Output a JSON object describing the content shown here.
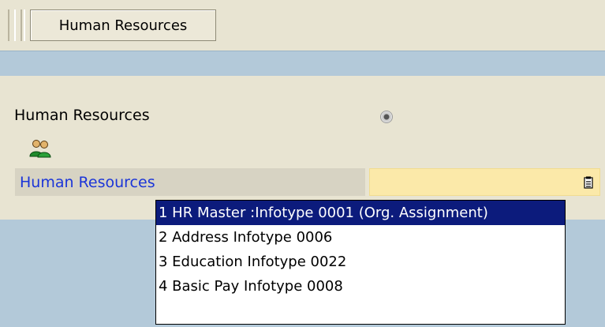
{
  "toolbar": {
    "button_label": "Human Resources"
  },
  "form": {
    "radio_label": "Human Resources",
    "field_label": "Human Resources",
    "field_value": "",
    "icons": {
      "people": "people-icon",
      "radio": "radio-button",
      "value_help": "value-help-icon"
    }
  },
  "dropdown": {
    "items": [
      {
        "label": "1 HR Master :Infotype 0001 (Org. Assignment)",
        "selected": true
      },
      {
        "label": "2 Address Infotype 0006",
        "selected": false
      },
      {
        "label": "3 Education Infotype 0022",
        "selected": false
      },
      {
        "label": "4 Basic Pay Infotype 0008",
        "selected": false
      }
    ]
  },
  "colors": {
    "background": "#e8e4d2",
    "band": "#b3c9d9",
    "label_blue": "#1b35d8",
    "input_yellow": "#fbe9a9",
    "selection": "#0c1b7c"
  }
}
